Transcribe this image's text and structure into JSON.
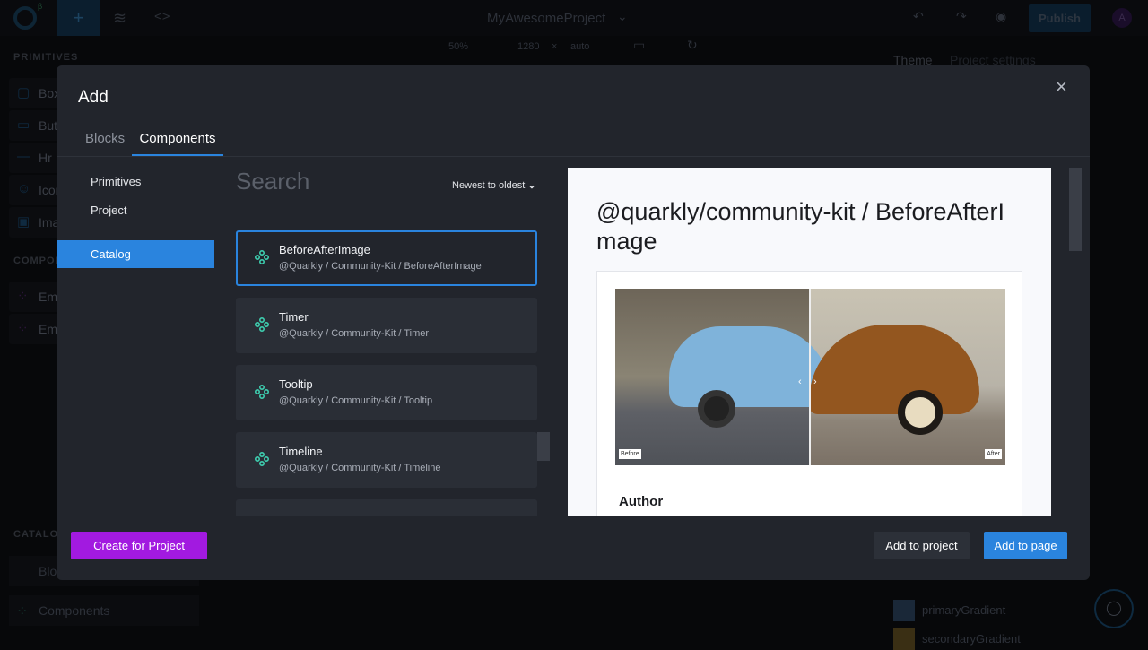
{
  "app": {
    "project_name": "MyAwesomeProject",
    "publish": "Publish",
    "avatar": "A",
    "zoom": "50%",
    "width": "1280",
    "times": "×",
    "height": "auto",
    "beta": "β"
  },
  "sidebar": {
    "primitives_title": "PRIMITIVES",
    "primitives": [
      "Box",
      "Button",
      "Hr",
      "Icon",
      "Image"
    ],
    "components_title": "COMPONENTS",
    "components": [
      "Em",
      "Em"
    ],
    "catalog_title": "CATALOG",
    "catalog": [
      "Blocks",
      "Components"
    ]
  },
  "right_panel": {
    "tabs": [
      "Theme",
      "Project settings"
    ],
    "gradients": [
      "primaryGradient",
      "secondaryGradient"
    ]
  },
  "modal": {
    "title": "Add",
    "tabs": [
      {
        "label": "Blocks",
        "active": false
      },
      {
        "label": "Components",
        "active": true
      }
    ],
    "nav": [
      "Primitives",
      "Project",
      "Catalog"
    ],
    "nav_selected": "Catalog",
    "search_placeholder": "Search",
    "sort": "Newest to oldest",
    "items": [
      {
        "title": "BeforeAfterImage",
        "path": "@Quarkly / Community-Kit / BeforeAfterImage",
        "selected": true
      },
      {
        "title": "Timer",
        "path": "@Quarkly / Community-Kit / Timer"
      },
      {
        "title": "Tooltip",
        "path": "@Quarkly / Community-Kit / Tooltip"
      },
      {
        "title": "Timeline",
        "path": "@Quarkly / Community-Kit / Timeline"
      }
    ],
    "preview": {
      "title": "@quarkly/community-kit / BeforeAfterImage",
      "before": "Before",
      "after": "After",
      "author_heading": "Author"
    },
    "create_button": "Create for Project",
    "add_project_button": "Add to project",
    "add_page_button": "Add to page"
  },
  "colors": {
    "accent": "#2a84de",
    "create": "#a21ae0",
    "icon": "#3ecfb0"
  }
}
